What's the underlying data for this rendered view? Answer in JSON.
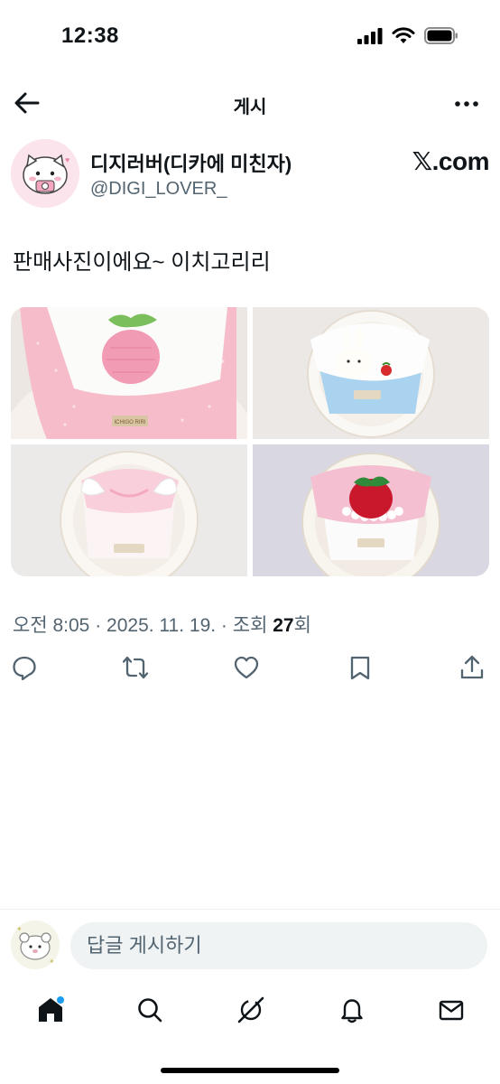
{
  "status": {
    "time": "12:38"
  },
  "header": {
    "title": "게시"
  },
  "author": {
    "name": "디지러버(디카에 미친자)",
    "handle": "@DIGI_LOVER_"
  },
  "source": {
    "label": "𝕏.com"
  },
  "post": {
    "text": "판매사진이에요~ 이치고리리"
  },
  "meta": {
    "time": "오전 8:05",
    "date": "2025. 11. 19.",
    "views_label": "조회",
    "views": "27",
    "views_suffix": "회",
    "separator": " · "
  },
  "reply": {
    "placeholder": "답글 게시하기"
  },
  "media": {
    "brand_label": "ICHIGO RIRI"
  },
  "icons": {
    "back": "arrow-left-icon",
    "more": "more-dots-icon",
    "reply": "comment-bubble-icon",
    "repost": "repost-arrows-icon",
    "like": "heart-icon",
    "bookmark": "bookmark-icon",
    "share": "share-upload-icon",
    "home": "home-icon",
    "search": "search-icon",
    "grok": "grok-slash-icon",
    "notifications": "bell-icon",
    "messages": "mail-icon"
  },
  "colors": {
    "accent": "#1d9bf0",
    "text": "#0f1419",
    "secondary": "#536471"
  }
}
